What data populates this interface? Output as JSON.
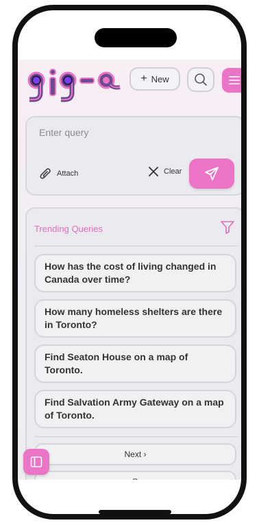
{
  "app": {
    "logo_text": "gig-a"
  },
  "header": {
    "new_label": "New",
    "new_icon": "plus-icon",
    "search_icon": "search-icon",
    "menu_icon": "menu-icon"
  },
  "query": {
    "placeholder": "Enter query",
    "attach_label": "Attach",
    "clear_label": "Clear",
    "send_icon": "send-icon"
  },
  "trending": {
    "title": "Trending Queries",
    "items": [
      {
        "text": "How has the cost of living changed in Canada over time?"
      },
      {
        "text": "How many homeless shelters are there in Toronto?"
      },
      {
        "text": "Find Seaton House on a map of Toronto."
      },
      {
        "text": "Find Salvation Army Gateway on a map of Toronto."
      }
    ],
    "next_label": "Next ›",
    "prev_label": "P"
  },
  "colors": {
    "accent": "#ec74c6",
    "accent_text": "#e06cba",
    "logo_fill": "#6b4a8f",
    "logo_outline": "#ec74c6",
    "logo_dot": "#7a3df0"
  }
}
